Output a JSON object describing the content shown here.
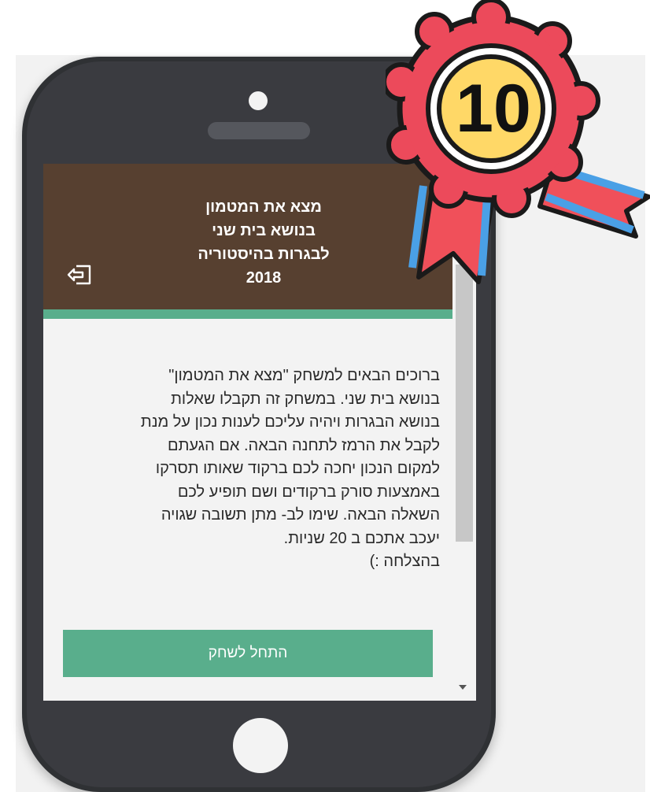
{
  "header": {
    "title": "מצא את המטמון\nבנושא בית שני\nלבגרות בהיסטוריה\n2018",
    "logout_icon": "logout-icon",
    "background": "#574030"
  },
  "intro": {
    "text": "ברוכים הבאים למשחק \"מצא את המטמון\"\nבנושא בית שני. במשחק זה תקבלו שאלות\nבנושא הבגרות ויהיה עליכם לענות נכון על מנת\nלקבל את הרמז לתחנה הבאה. אם הגעתם\nלמקום הנכון יחכה לכם ברקוד שאותו תסרקו\nבאמצעות סורק ברקודים ושם תופיע לכם\nהשאלה הבאה. שימו לב- מתן תשובה שגויה\nיעכב אתכם ב 20 שניות.\nבהצלחה :)"
  },
  "actions": {
    "start_label": "התחל לשחק",
    "accent": "#59ae8c"
  },
  "badge": {
    "number": "10",
    "icon": "award-ribbon-icon"
  }
}
